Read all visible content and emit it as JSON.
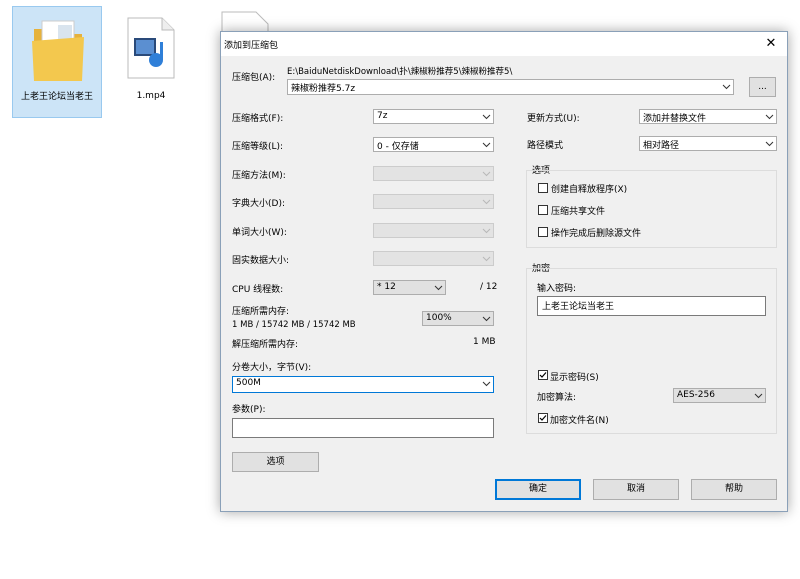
{
  "desktop": {
    "icons": [
      {
        "label": "上老王论坛当老王",
        "icon": "folder-icon",
        "selected": true
      },
      {
        "label": "1.mp4",
        "icon": "video-file-icon"
      },
      {
        "label": "",
        "icon": "file-icon"
      }
    ]
  },
  "dialog": {
    "title": "添加到压缩包",
    "close": "✕",
    "archive": {
      "label": "压缩包(A):",
      "path": "E:\\BaiduNetdiskDownload\\扑\\辣椒粉推荐5\\辣椒粉推荐5\\",
      "filename": "辣椒粉推荐5.7z",
      "browse": "..."
    },
    "left": {
      "format": {
        "label": "压缩格式(F):",
        "value": "7z"
      },
      "level": {
        "label": "压缩等级(L):",
        "value": "0 - 仅存储"
      },
      "method": {
        "label": "压缩方法(M):"
      },
      "dict": {
        "label": "字典大小(D):"
      },
      "word": {
        "label": "单词大小(W):"
      },
      "solid": {
        "label": "固实数据大小:"
      },
      "cpu": {
        "label": "CPU 线程数:",
        "value": "* 12",
        "total": "/ 12"
      },
      "mem_compress": {
        "label": "压缩所需内存:",
        "detail": "1 MB / 15742 MB / 15742 MB",
        "value": "100%"
      },
      "mem_decompress": {
        "label": "解压缩所需内存:",
        "value": "1 MB"
      },
      "volume": {
        "label": "分卷大小，字节(V):",
        "value": "500M"
      },
      "params": {
        "label": "参数(P):",
        "value": ""
      },
      "options_button": "选项"
    },
    "right": {
      "update": {
        "label": "更新方式(U):",
        "value": "添加并替换文件"
      },
      "path_mode": {
        "label": "路径模式",
        "value": "相对路径"
      },
      "options": {
        "title": "选项",
        "sfx": {
          "label": "创建自释放程序(X)",
          "checked": false
        },
        "shared": {
          "label": "压缩共享文件",
          "checked": false
        },
        "delete": {
          "label": "操作完成后删除源文件",
          "checked": false
        }
      },
      "encryption": {
        "title": "加密",
        "password_label": "输入密码:",
        "password": "上老王论坛当老王",
        "show": {
          "label": "显示密码(S)",
          "checked": true
        },
        "method_label": "加密算法:",
        "method": "AES-256",
        "encrypt_names": {
          "label": "加密文件名(N)",
          "checked": true
        }
      }
    },
    "buttons": {
      "ok": "确定",
      "cancel": "取消",
      "help": "帮助"
    }
  },
  "colors": {
    "accent": "#0078d7",
    "selection": "#cce4f7",
    "folder": "#f3c84e"
  }
}
